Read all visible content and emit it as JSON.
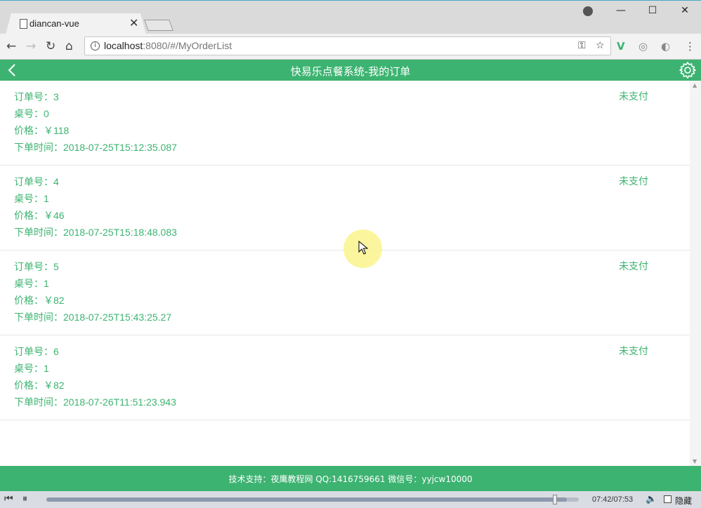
{
  "browser": {
    "tab_title": "diancan-vue",
    "url_host": "localhost",
    "url_rest": ":8080/#/MyOrderList"
  },
  "app": {
    "title": "快易乐点餐系统-我的订单",
    "accent": "#3db371"
  },
  "orders": [
    {
      "id_line": "订单号：3",
      "table_line": "桌号：0",
      "price_line": "价格：￥118",
      "time_line": "下单时间：2018-07-25T15:12:35.087",
      "status": "未支付"
    },
    {
      "id_line": "订单号：4",
      "table_line": "桌号：1",
      "price_line": "价格：￥46",
      "time_line": "下单时间：2018-07-25T15:18:48.083",
      "status": "未支付"
    },
    {
      "id_line": "订单号：5",
      "table_line": "桌号：1",
      "price_line": "价格：￥82",
      "time_line": "下单时间：2018-07-25T15:43:25.27",
      "status": "未支付"
    },
    {
      "id_line": "订单号：6",
      "table_line": "桌号：1",
      "price_line": "价格：￥82",
      "time_line": "下单时间：2018-07-26T11:51:23.943",
      "status": "未支付"
    }
  ],
  "footer": {
    "text": "技术支持：夜鹰教程网 QQ:1416759661 微信号：yyjcw10000"
  },
  "player": {
    "time": "07:42/07:53",
    "hide_label": "隐藏",
    "progress_fraction": 0.977
  }
}
